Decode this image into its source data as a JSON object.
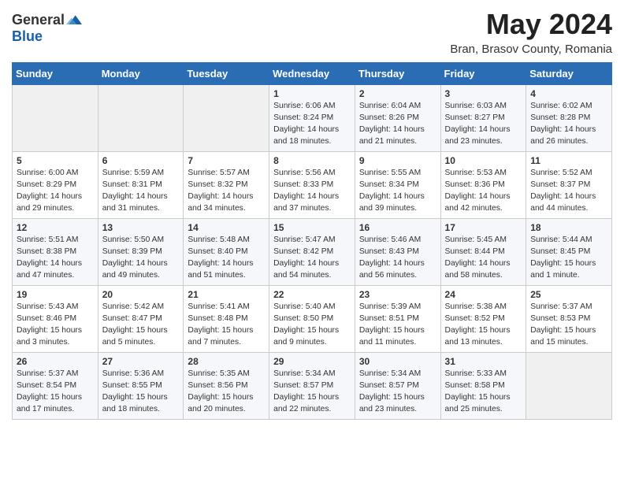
{
  "header": {
    "logo_general": "General",
    "logo_blue": "Blue",
    "month_title": "May 2024",
    "location": "Bran, Brasov County, Romania"
  },
  "calendar": {
    "day_headers": [
      "Sunday",
      "Monday",
      "Tuesday",
      "Wednesday",
      "Thursday",
      "Friday",
      "Saturday"
    ],
    "weeks": [
      [
        {
          "day": "",
          "info": ""
        },
        {
          "day": "",
          "info": ""
        },
        {
          "day": "",
          "info": ""
        },
        {
          "day": "1",
          "info": "Sunrise: 6:06 AM\nSunset: 8:24 PM\nDaylight: 14 hours\nand 18 minutes."
        },
        {
          "day": "2",
          "info": "Sunrise: 6:04 AM\nSunset: 8:26 PM\nDaylight: 14 hours\nand 21 minutes."
        },
        {
          "day": "3",
          "info": "Sunrise: 6:03 AM\nSunset: 8:27 PM\nDaylight: 14 hours\nand 23 minutes."
        },
        {
          "day": "4",
          "info": "Sunrise: 6:02 AM\nSunset: 8:28 PM\nDaylight: 14 hours\nand 26 minutes."
        }
      ],
      [
        {
          "day": "5",
          "info": "Sunrise: 6:00 AM\nSunset: 8:29 PM\nDaylight: 14 hours\nand 29 minutes."
        },
        {
          "day": "6",
          "info": "Sunrise: 5:59 AM\nSunset: 8:31 PM\nDaylight: 14 hours\nand 31 minutes."
        },
        {
          "day": "7",
          "info": "Sunrise: 5:57 AM\nSunset: 8:32 PM\nDaylight: 14 hours\nand 34 minutes."
        },
        {
          "day": "8",
          "info": "Sunrise: 5:56 AM\nSunset: 8:33 PM\nDaylight: 14 hours\nand 37 minutes."
        },
        {
          "day": "9",
          "info": "Sunrise: 5:55 AM\nSunset: 8:34 PM\nDaylight: 14 hours\nand 39 minutes."
        },
        {
          "day": "10",
          "info": "Sunrise: 5:53 AM\nSunset: 8:36 PM\nDaylight: 14 hours\nand 42 minutes."
        },
        {
          "day": "11",
          "info": "Sunrise: 5:52 AM\nSunset: 8:37 PM\nDaylight: 14 hours\nand 44 minutes."
        }
      ],
      [
        {
          "day": "12",
          "info": "Sunrise: 5:51 AM\nSunset: 8:38 PM\nDaylight: 14 hours\nand 47 minutes."
        },
        {
          "day": "13",
          "info": "Sunrise: 5:50 AM\nSunset: 8:39 PM\nDaylight: 14 hours\nand 49 minutes."
        },
        {
          "day": "14",
          "info": "Sunrise: 5:48 AM\nSunset: 8:40 PM\nDaylight: 14 hours\nand 51 minutes."
        },
        {
          "day": "15",
          "info": "Sunrise: 5:47 AM\nSunset: 8:42 PM\nDaylight: 14 hours\nand 54 minutes."
        },
        {
          "day": "16",
          "info": "Sunrise: 5:46 AM\nSunset: 8:43 PM\nDaylight: 14 hours\nand 56 minutes."
        },
        {
          "day": "17",
          "info": "Sunrise: 5:45 AM\nSunset: 8:44 PM\nDaylight: 14 hours\nand 58 minutes."
        },
        {
          "day": "18",
          "info": "Sunrise: 5:44 AM\nSunset: 8:45 PM\nDaylight: 15 hours\nand 1 minute."
        }
      ],
      [
        {
          "day": "19",
          "info": "Sunrise: 5:43 AM\nSunset: 8:46 PM\nDaylight: 15 hours\nand 3 minutes."
        },
        {
          "day": "20",
          "info": "Sunrise: 5:42 AM\nSunset: 8:47 PM\nDaylight: 15 hours\nand 5 minutes."
        },
        {
          "day": "21",
          "info": "Sunrise: 5:41 AM\nSunset: 8:48 PM\nDaylight: 15 hours\nand 7 minutes."
        },
        {
          "day": "22",
          "info": "Sunrise: 5:40 AM\nSunset: 8:50 PM\nDaylight: 15 hours\nand 9 minutes."
        },
        {
          "day": "23",
          "info": "Sunrise: 5:39 AM\nSunset: 8:51 PM\nDaylight: 15 hours\nand 11 minutes."
        },
        {
          "day": "24",
          "info": "Sunrise: 5:38 AM\nSunset: 8:52 PM\nDaylight: 15 hours\nand 13 minutes."
        },
        {
          "day": "25",
          "info": "Sunrise: 5:37 AM\nSunset: 8:53 PM\nDaylight: 15 hours\nand 15 minutes."
        }
      ],
      [
        {
          "day": "26",
          "info": "Sunrise: 5:37 AM\nSunset: 8:54 PM\nDaylight: 15 hours\nand 17 minutes."
        },
        {
          "day": "27",
          "info": "Sunrise: 5:36 AM\nSunset: 8:55 PM\nDaylight: 15 hours\nand 18 minutes."
        },
        {
          "day": "28",
          "info": "Sunrise: 5:35 AM\nSunset: 8:56 PM\nDaylight: 15 hours\nand 20 minutes."
        },
        {
          "day": "29",
          "info": "Sunrise: 5:34 AM\nSunset: 8:57 PM\nDaylight: 15 hours\nand 22 minutes."
        },
        {
          "day": "30",
          "info": "Sunrise: 5:34 AM\nSunset: 8:57 PM\nDaylight: 15 hours\nand 23 minutes."
        },
        {
          "day": "31",
          "info": "Sunrise: 5:33 AM\nSunset: 8:58 PM\nDaylight: 15 hours\nand 25 minutes."
        },
        {
          "day": "",
          "info": ""
        }
      ]
    ]
  }
}
